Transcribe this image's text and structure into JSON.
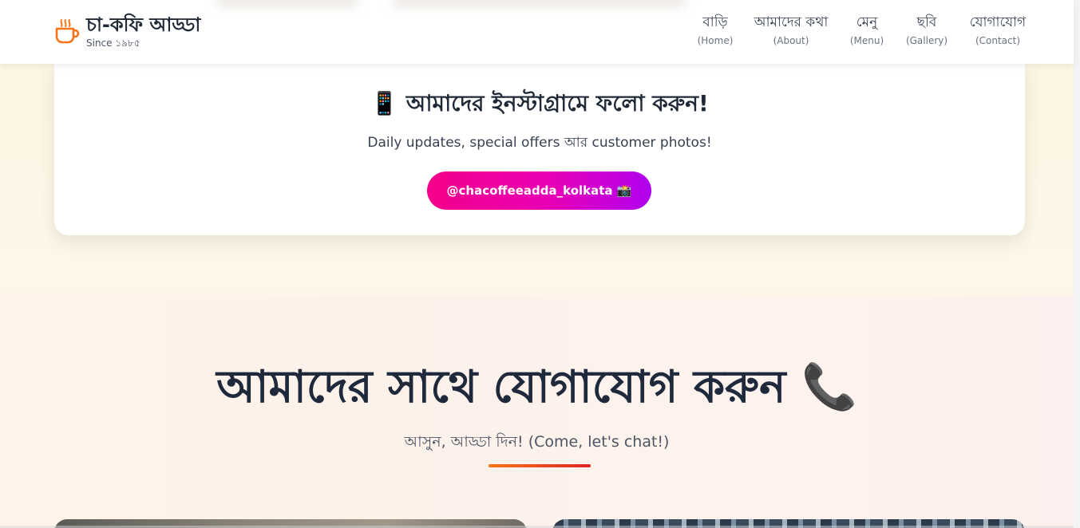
{
  "brand": {
    "name": "চা-কফি আড্ডা",
    "since": "Since ১৯৮৫",
    "accent_color": "#f97316",
    "logo_icon": "coffee-cup-icon"
  },
  "nav": {
    "items": [
      {
        "bn": "বাড়ি",
        "en": "(Home)"
      },
      {
        "bn": "আমাদের কথা",
        "en": "(About)"
      },
      {
        "bn": "মেনু",
        "en": "(Menu)"
      },
      {
        "bn": "ছবি",
        "en": "(Gallery)"
      },
      {
        "bn": "যোগাযোগ",
        "en": "(Contact)"
      }
    ]
  },
  "instagram": {
    "icon": "mobile-phone-icon",
    "icon_glyph": "📱",
    "title": "আমাদের ইনস্টাগ্রামে ফলো করুন!",
    "subtitle": "Daily updates, special offers আর customer photos!",
    "button_label": "@chacoffeeadda_kolkata 📸",
    "button_gradient_start": "#f5008a",
    "button_gradient_end": "#b000f0"
  },
  "contact": {
    "title": "আমাদের সাথে যোগাযোগ করুন 📞",
    "subtitle": "আসুন, আড্ডা দিন! (Come, let's chat!)",
    "divider_color_start": "#f97316",
    "divider_color_end": "#dc2626"
  }
}
